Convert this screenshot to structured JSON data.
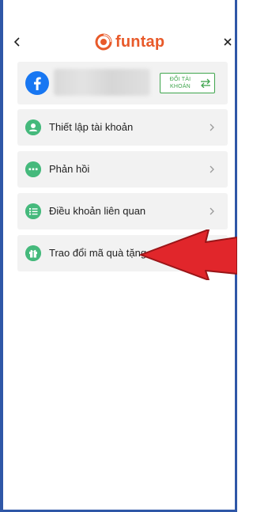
{
  "header": {
    "logo_text": "funtap",
    "back_icon": "chevron-left-icon",
    "close_icon": "close-icon"
  },
  "account": {
    "provider_icon": "facebook-icon",
    "switch_label": "ĐỔI TÀI KHOẢN",
    "switch_icon": "swap-arrows-icon"
  },
  "menu": {
    "items": [
      {
        "label": "Thiết lập tài khoản",
        "icon": "user-icon",
        "has_chevron": true
      },
      {
        "label": "Phản hồi",
        "icon": "chat-dots-icon",
        "has_chevron": true
      },
      {
        "label": "Điều khoản liên quan",
        "icon": "list-icon",
        "has_chevron": true
      },
      {
        "label": "Trao đổi mã quà tặng",
        "icon": "gift-icon",
        "has_chevron": false
      }
    ]
  },
  "colors": {
    "accent_green": "#45b97c",
    "border_green": "#3fa54d",
    "logo_orange": "#e85a2a",
    "facebook_blue": "#1877f2",
    "frame_blue": "#2f57a7",
    "annotation_red": "#e1262b"
  }
}
